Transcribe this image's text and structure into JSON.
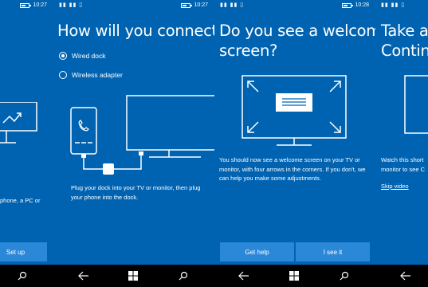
{
  "panel1": {
    "time": "10:27",
    "body": "phone, a PC or",
    "button": "Set up"
  },
  "panel2": {
    "time": "10:27",
    "title": "How will you connect?",
    "options": [
      {
        "label": "Wired dock",
        "selected": true
      },
      {
        "label": "Wireless adapter",
        "selected": false
      }
    ],
    "body": "Plug your dock into your TV or monitor, then plug your phone into the dock."
  },
  "panel3": {
    "time": "10:28",
    "title_line1": "Do you see a welcome",
    "title_line2": "screen?",
    "body": "You should now see a welcome screen on your TV or monitor, with four arrows in the corners. If you don't, we can help you make some adjustments.",
    "buttons": {
      "help": "Get help",
      "ok": "I see it"
    }
  },
  "panel4": {
    "title_line1": "Take a c",
    "title_line2": "Continu",
    "body": "Watch this short monitor to see C",
    "link": "Skip video"
  },
  "colors": {
    "background": "#0063b1",
    "button": "#2b88d8",
    "navbar": "#000000"
  },
  "navbar_icons": [
    "search-icon",
    "back-icon",
    "windows-icon",
    "search-icon",
    "back-icon",
    "windows-icon",
    "search-icon",
    "back-icon"
  ]
}
